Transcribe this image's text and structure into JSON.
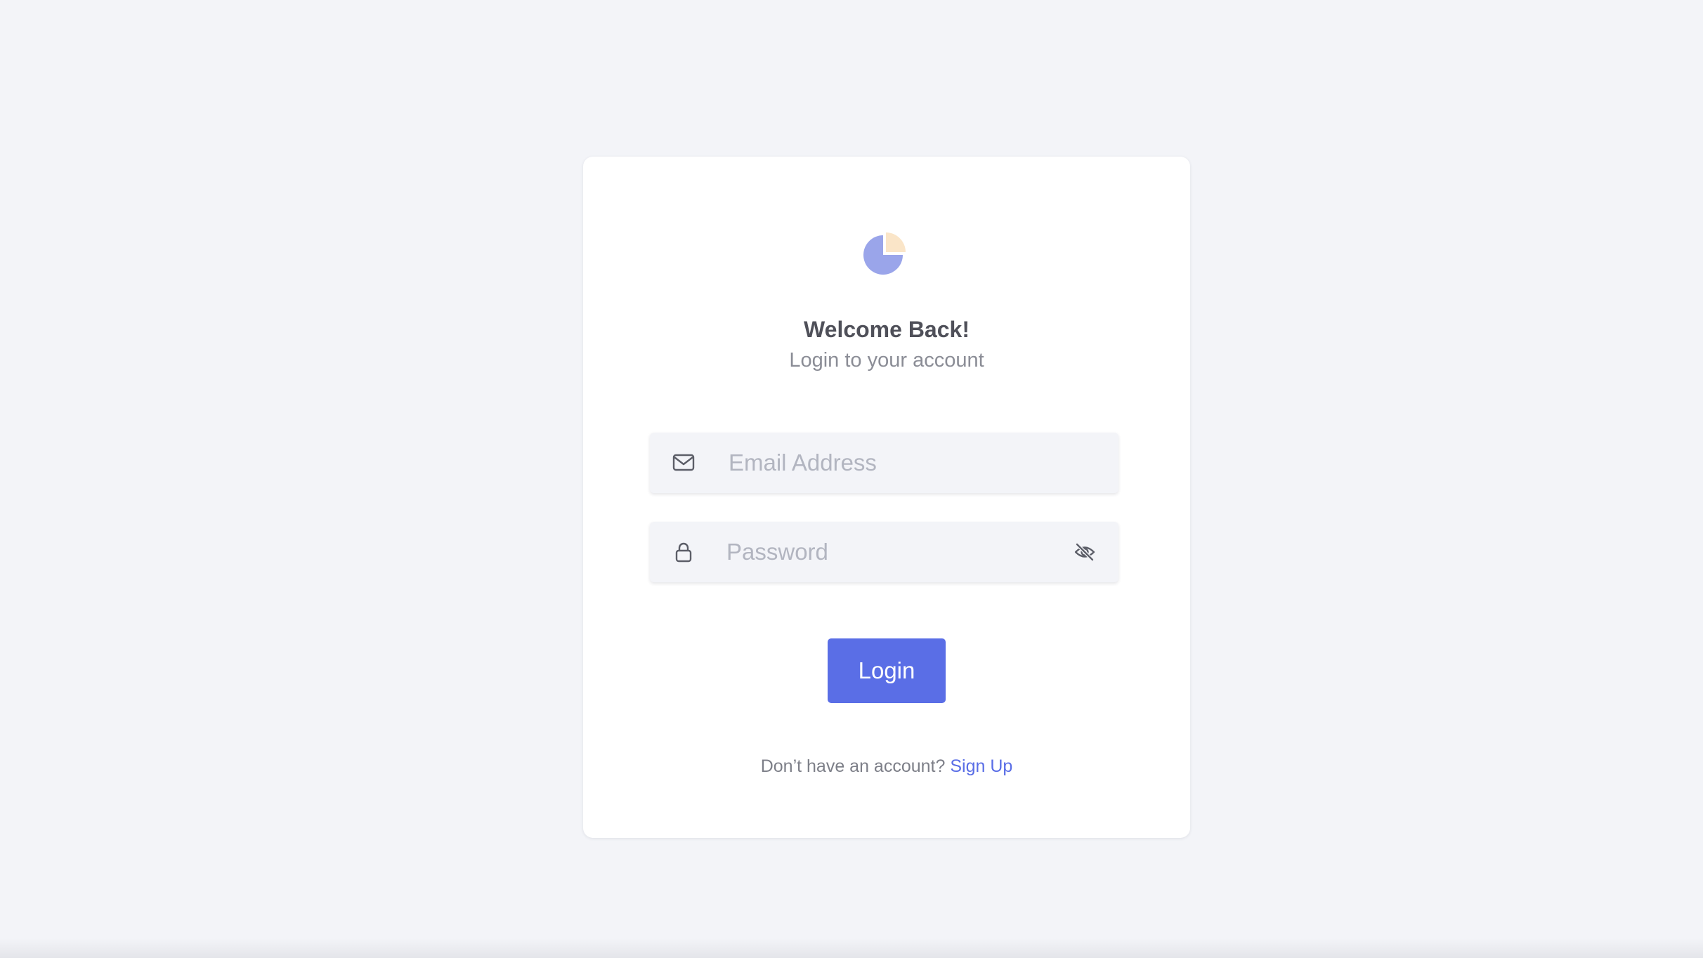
{
  "colors": {
    "page_background": "#f3f4f8",
    "card_background": "#ffffff",
    "accent": "#5a6ee6",
    "logo_primary": "#9aa5ea",
    "logo_secondary": "#fae5c8"
  },
  "login": {
    "title": "Welcome Back!",
    "subtitle": "Login to your account",
    "email_field": {
      "icon": "mail-icon",
      "placeholder": "Email Address",
      "value": ""
    },
    "password_field": {
      "icon": "lock-icon",
      "placeholder": "Password",
      "value": "",
      "toggle_icon": "eye-off-icon"
    },
    "submit_label": "Login",
    "signup_prompt": "Don’t have an account?",
    "signup_link": "Sign Up"
  }
}
